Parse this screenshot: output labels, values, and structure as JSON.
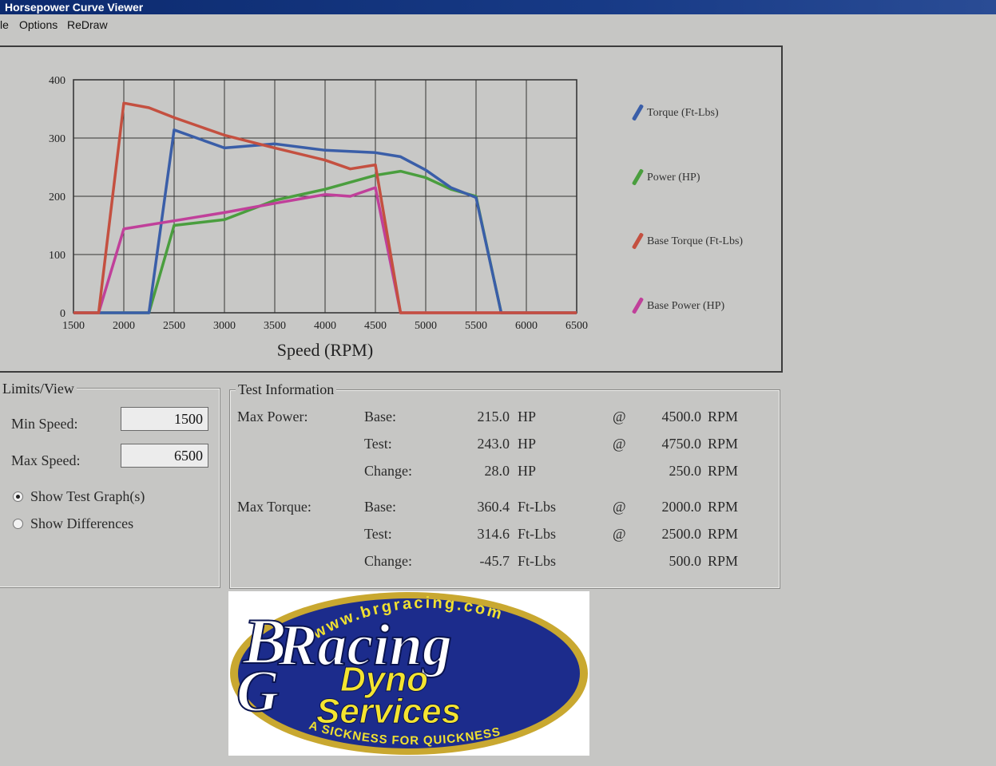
{
  "window": {
    "title": "Horsepower Curve Viewer"
  },
  "menu": {
    "file_partial": "le",
    "options": "Options",
    "redraw": "ReDraw"
  },
  "colors": {
    "torque": "#3a5ea8",
    "power": "#4a9e3e",
    "base_torque": "#c45040",
    "base_power": "#c0409a",
    "titlebar": "#173a86"
  },
  "chart_data": {
    "type": "line",
    "xlabel": "Speed (RPM)",
    "ylabel": "",
    "xlim": [
      1500,
      6500
    ],
    "ylim": [
      0,
      400
    ],
    "x_ticks": [
      "1500",
      "2000",
      "2500",
      "3000",
      "3500",
      "4000",
      "4500",
      "5000",
      "5500",
      "6000",
      "6500"
    ],
    "y_ticks": [
      "0",
      "100",
      "200",
      "300",
      "400"
    ],
    "grid": true,
    "legend_position": "right",
    "series": [
      {
        "name": "Torque (Ft-Lbs)",
        "color_key": "torque",
        "points": [
          [
            1500,
            0
          ],
          [
            2000,
            0
          ],
          [
            2250,
            0
          ],
          [
            2500,
            314
          ],
          [
            3000,
            283
          ],
          [
            3500,
            290
          ],
          [
            4000,
            279
          ],
          [
            4500,
            275
          ],
          [
            4750,
            268
          ],
          [
            5000,
            245
          ],
          [
            5250,
            215
          ],
          [
            5500,
            198
          ],
          [
            5750,
            0
          ],
          [
            6500,
            0
          ]
        ]
      },
      {
        "name": "Power (HP)",
        "color_key": "power",
        "points": [
          [
            1500,
            0
          ],
          [
            2000,
            0
          ],
          [
            2250,
            0
          ],
          [
            2500,
            150
          ],
          [
            3000,
            160
          ],
          [
            3500,
            193
          ],
          [
            4000,
            212
          ],
          [
            4500,
            236
          ],
          [
            4750,
            243
          ],
          [
            5000,
            232
          ],
          [
            5250,
            212
          ],
          [
            5500,
            200
          ],
          [
            5750,
            0
          ],
          [
            6500,
            0
          ]
        ]
      },
      {
        "name": "Base Torque (Ft-Lbs)",
        "color_key": "base_torque",
        "points": [
          [
            1500,
            0
          ],
          [
            1750,
            0
          ],
          [
            2000,
            360
          ],
          [
            2250,
            352
          ],
          [
            2500,
            335
          ],
          [
            3000,
            305
          ],
          [
            3500,
            283
          ],
          [
            4000,
            262
          ],
          [
            4250,
            247
          ],
          [
            4500,
            254
          ],
          [
            4750,
            0
          ],
          [
            6500,
            0
          ]
        ]
      },
      {
        "name": "Base Power (HP)",
        "color_key": "base_power",
        "points": [
          [
            1500,
            0
          ],
          [
            1750,
            0
          ],
          [
            2000,
            144
          ],
          [
            2500,
            158
          ],
          [
            3000,
            172
          ],
          [
            3500,
            188
          ],
          [
            4000,
            203
          ],
          [
            4250,
            200
          ],
          [
            4500,
            215
          ],
          [
            4750,
            0
          ],
          [
            6500,
            0
          ]
        ]
      }
    ]
  },
  "limits": {
    "title": "Limits/View",
    "min_label": "Min Speed:",
    "min_value": "1500",
    "max_label": "Max Speed:",
    "max_value": "6500",
    "radio1": "Show Test Graph(s)",
    "radio2": "Show Differences",
    "selected": "radio1"
  },
  "test_info": {
    "title": "Test Information",
    "max_power_label": "Max Power:",
    "max_torque_label": "Max Torque:",
    "power_rows": [
      {
        "label": "Base:",
        "value": "215.0",
        "unit": "HP",
        "at": "@",
        "rpm": "4500.0",
        "rpm_unit": "RPM"
      },
      {
        "label": "Test:",
        "value": "243.0",
        "unit": "HP",
        "at": "@",
        "rpm": "4750.0",
        "rpm_unit": "RPM"
      },
      {
        "label": "Change:",
        "value": "28.0",
        "unit": "HP",
        "at": "",
        "rpm": "250.0",
        "rpm_unit": "RPM"
      }
    ],
    "torque_rows": [
      {
        "label": "Base:",
        "value": "360.4",
        "unit": "Ft-Lbs",
        "at": "@",
        "rpm": "2000.0",
        "rpm_unit": "RPM"
      },
      {
        "label": "Test:",
        "value": "314.6",
        "unit": "Ft-Lbs",
        "at": "@",
        "rpm": "2500.0",
        "rpm_unit": "RPM"
      },
      {
        "label": "Change:",
        "value": "-45.7",
        "unit": "Ft-Lbs",
        "at": "",
        "rpm": "500.0",
        "rpm_unit": "RPM"
      }
    ]
  },
  "logo": {
    "url_text": "www.brgracing.com",
    "brand_b": "B",
    "brand_racing": "Racing",
    "brand_g": "G",
    "line1": "Dyno",
    "line2": "Services",
    "slogan": "A SICKNESS FOR QUICKNESS"
  }
}
